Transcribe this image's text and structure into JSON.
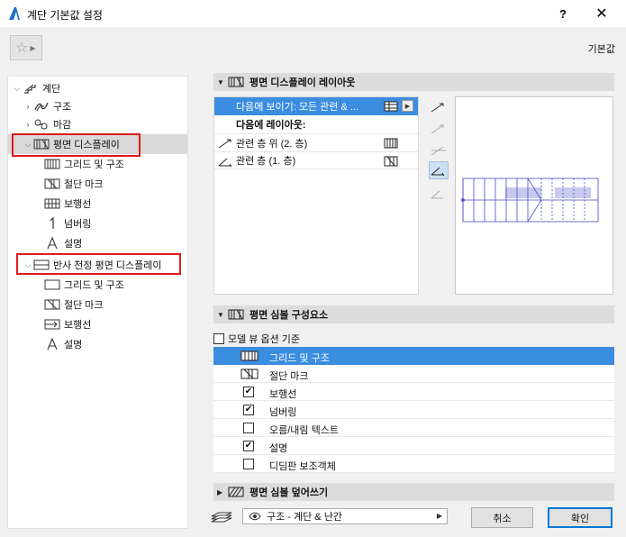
{
  "window": {
    "title": "계단 기본값 설정",
    "help_label": "?",
    "close_label": "✕"
  },
  "favorites": {
    "star": "☆",
    "arrow": "▶"
  },
  "preset_label": "기본값",
  "tree": {
    "items": [
      {
        "label": "계단",
        "icon": "stair-icon",
        "expander": "chevron-down"
      },
      {
        "label": "구조",
        "icon": "structure-icon",
        "expander": "chevron-right"
      },
      {
        "label": "마감",
        "icon": "finish-icon",
        "expander": "chevron-right"
      },
      {
        "label": "평면 디스플레이",
        "icon": "floor-plan-display-icon",
        "expander": "chevron-down"
      },
      {
        "label": "그리드 및 구조",
        "icon": "grid-structure-icon",
        "expander": ""
      },
      {
        "label": "절단 마크",
        "icon": "break-mark-icon",
        "expander": ""
      },
      {
        "label": "보행선",
        "icon": "walking-line-icon",
        "expander": ""
      },
      {
        "label": "넘버링",
        "icon": "numbering-icon",
        "expander": ""
      },
      {
        "label": "설명",
        "icon": "description-icon",
        "expander": ""
      },
      {
        "label": "반사 천정 평면 디스플레이",
        "icon": "rcp-display-icon",
        "expander": "chevron-down"
      },
      {
        "label": "그리드 및 구조",
        "icon": "grid-structure-outline-icon",
        "expander": ""
      },
      {
        "label": "절단 마크",
        "icon": "break-mark-icon",
        "expander": ""
      },
      {
        "label": "보행선",
        "icon": "walking-line-icon",
        "expander": ""
      },
      {
        "label": "설명",
        "icon": "description-icon",
        "expander": ""
      }
    ]
  },
  "floor_plan_layout": {
    "header": "평면 디스플레이 레이아웃",
    "rows": [
      {
        "label": "다음에 보이기: 모든 관련 & ...",
        "more": "▶"
      },
      {
        "label": "다음에 레이아웃:"
      },
      {
        "label": "관련 층 위 (2. 층)"
      },
      {
        "label": "관련 층 (1. 층)"
      }
    ]
  },
  "floor_plan_components": {
    "header": "평면 심볼 구성요소",
    "model_view_option": "모델 뷰 옵션 기준",
    "rows": [
      {
        "label": "그리드 및 구조",
        "type": "icon",
        "icon": "grid-structure-icon"
      },
      {
        "label": "절단 마크",
        "type": "icon",
        "icon": "break-mark-icon"
      },
      {
        "label": "보행선",
        "type": "check",
        "checked": "✔"
      },
      {
        "label": "넘버링",
        "type": "check",
        "checked": "✔"
      },
      {
        "label": "오름/내림 텍스트",
        "type": "check",
        "checked": ""
      },
      {
        "label": "설명",
        "type": "check",
        "checked": "✔"
      },
      {
        "label": "디딤판 보조객체",
        "type": "check",
        "checked": ""
      }
    ]
  },
  "overrides": {
    "header": "평면 심볼 덮어쓰기"
  },
  "bottom": {
    "layer_value": "구조 - 계단 & 난간",
    "cancel_label": "취소",
    "ok_label": "확인"
  },
  "colors": {
    "selection": "#3b8de0",
    "highlight_box": "#e0191a",
    "preview_line": "#4a4ac8",
    "preview_fill": "#c8c8f0"
  }
}
